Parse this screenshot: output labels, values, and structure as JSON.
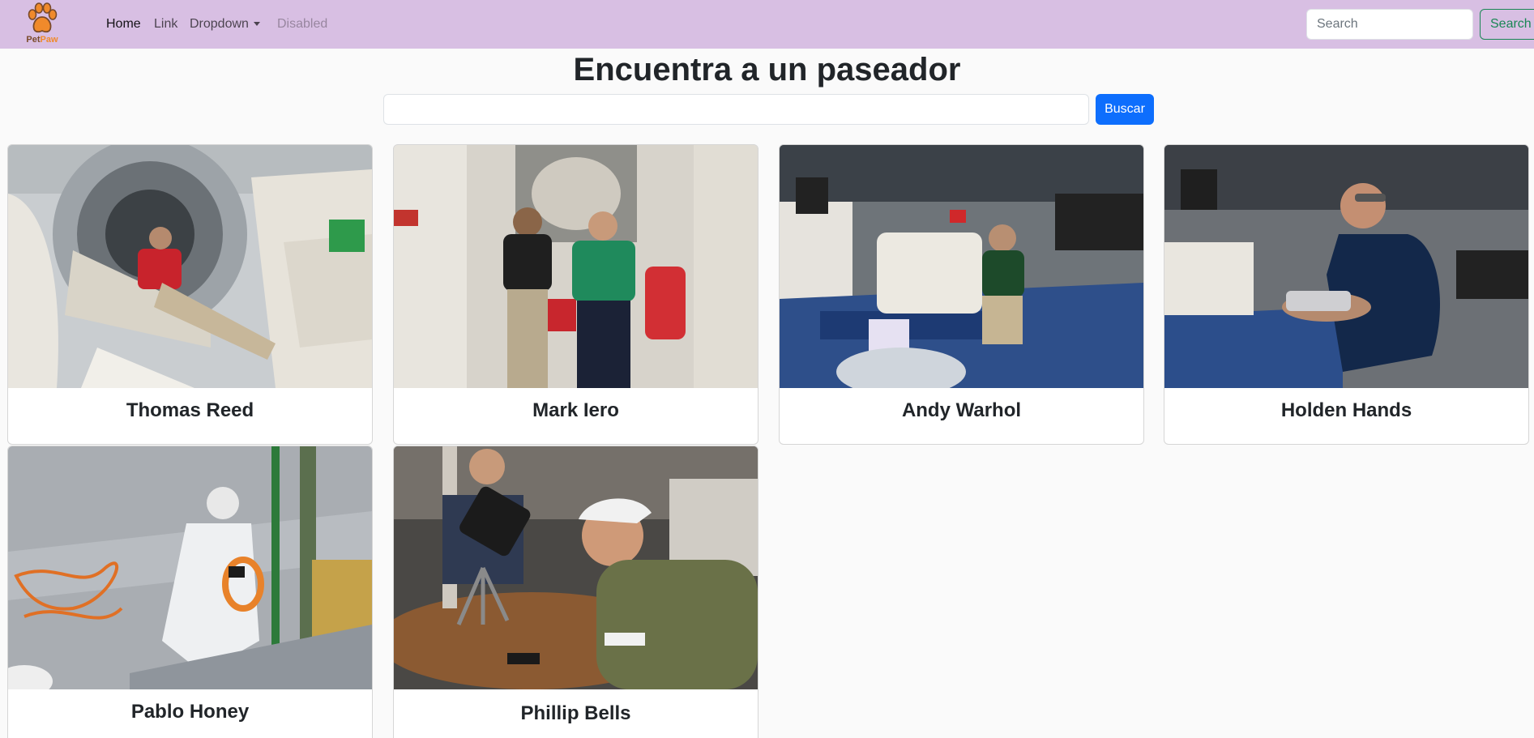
{
  "navbar": {
    "brand": {
      "name_part1": "Pet",
      "name_part2": "Paw"
    },
    "links": [
      "Home",
      "Link",
      "Dropdown",
      "Disabled"
    ],
    "search": {
      "placeholder": "Search",
      "button_label": "Search"
    }
  },
  "header": {
    "title": "Encuentra a un paseador"
  },
  "finder": {
    "input_value": "",
    "button_label": "Buscar"
  },
  "walkers": [
    {
      "name": "Thomas Reed"
    },
    {
      "name": "Mark Iero"
    },
    {
      "name": "Andy Warhol"
    },
    {
      "name": "Holden Hands"
    },
    {
      "name": "Pablo Honey"
    },
    {
      "name": "Phillip Bells"
    }
  ],
  "colors": {
    "navbar_bg": "#d8bfe3",
    "primary": "#0d6efd",
    "success_outline": "#198754",
    "brand_paw": "#f08a2b"
  }
}
